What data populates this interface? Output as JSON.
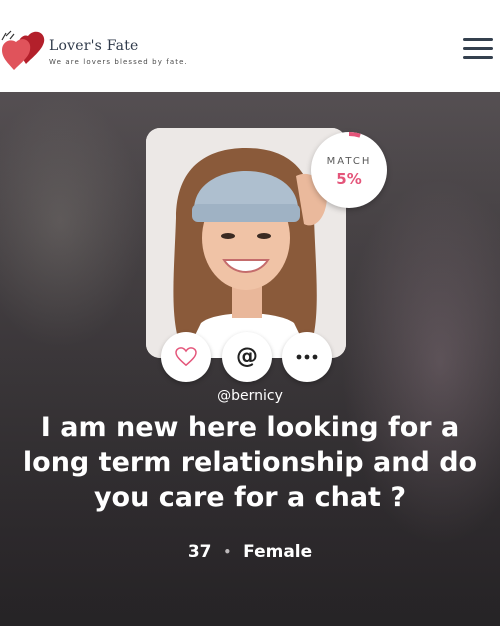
{
  "app": {
    "name": "Lover's Fate",
    "tagline": "We are lovers blessed by fate.",
    "colors": {
      "accent": "#e4557a",
      "heart_dark": "#b3202b",
      "heart_light": "#e0535b",
      "header_text": "#2f3a4a"
    }
  },
  "header": {
    "menu_icon": "hamburger-menu-icon"
  },
  "profile": {
    "match_label": "MATCH",
    "match_value": "5%",
    "match_fraction": 0.05,
    "username": "@bernicy",
    "bio": "I am new here looking for a long term relationship and do you care for a chat ?",
    "age": "37",
    "separator": "•",
    "gender": "Female",
    "actions": [
      {
        "icon": "heart-icon"
      },
      {
        "icon": "at-sign-icon",
        "label": "@"
      },
      {
        "icon": "more-dots-icon"
      }
    ]
  }
}
